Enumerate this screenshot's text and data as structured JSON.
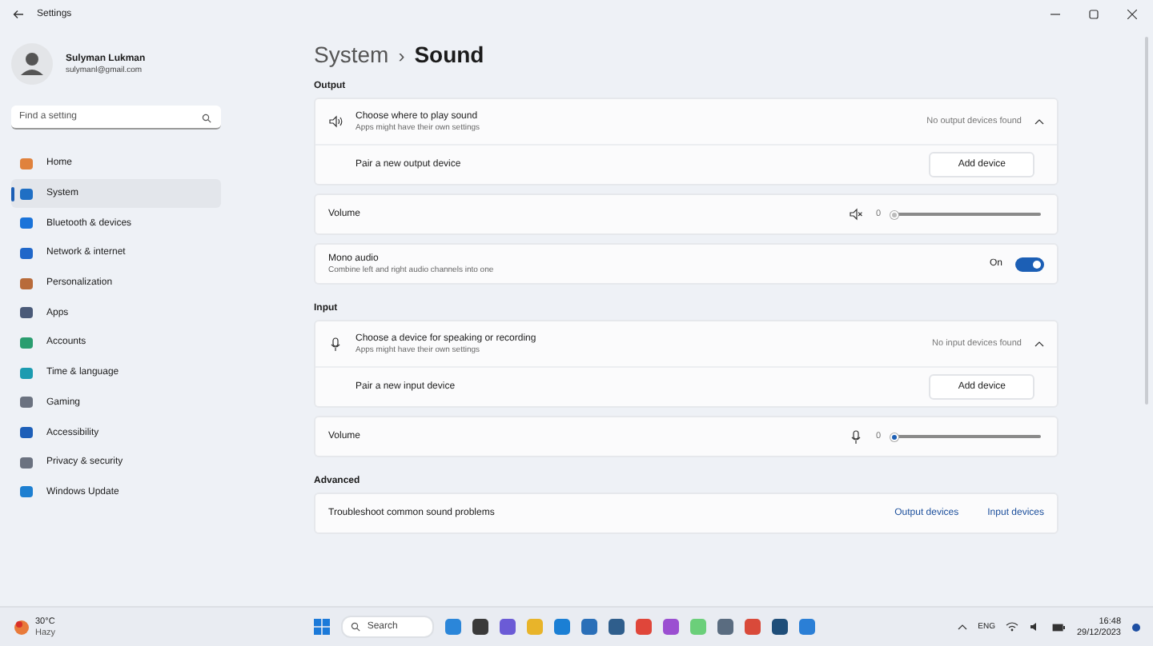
{
  "window": {
    "title": "Settings"
  },
  "profile": {
    "name": "Sulyman Lukman",
    "email": "sulymanl@gmail.com"
  },
  "search": {
    "placeholder": "Find a setting"
  },
  "nav": [
    {
      "label": "Home",
      "selected": false
    },
    {
      "label": "System",
      "selected": true
    },
    {
      "label": "Bluetooth & devices",
      "selected": false
    },
    {
      "label": "Network & internet",
      "selected": false
    },
    {
      "label": "Personalization",
      "selected": false
    },
    {
      "label": "Apps",
      "selected": false
    },
    {
      "label": "Accounts",
      "selected": false
    },
    {
      "label": "Time & language",
      "selected": false
    },
    {
      "label": "Gaming",
      "selected": false
    },
    {
      "label": "Accessibility",
      "selected": false
    },
    {
      "label": "Privacy & security",
      "selected": false
    },
    {
      "label": "Windows Update",
      "selected": false
    }
  ],
  "breadcrumb": {
    "parent": "System",
    "separator": "›",
    "current": "Sound"
  },
  "sections": [
    {
      "heading": "Output",
      "cards": [
        {
          "kind": "expander",
          "title": "Choose where to play sound",
          "subtitle": "Apps might have their own settings",
          "value": "No output devices found",
          "expanded": true,
          "sub_label": "Pair a new output device",
          "button": "Add device"
        },
        {
          "kind": "slider",
          "label": "Volume",
          "reading": "0",
          "level": 0,
          "disabled": true
        },
        {
          "kind": "toggle",
          "title": "Mono audio",
          "subtitle": "Combine left and right audio channels into one",
          "state_label": "On",
          "on": true
        }
      ]
    },
    {
      "heading": "Input",
      "cards": [
        {
          "kind": "expander",
          "title": "Choose a device for speaking or recording",
          "subtitle": "Apps might have their own settings",
          "value": "No input devices found",
          "expanded": true,
          "sub_label": "Pair a new input device",
          "button": "Add device"
        },
        {
          "kind": "slider",
          "label": "Volume",
          "reading": "0",
          "level": 0,
          "disabled": false
        }
      ]
    },
    {
      "heading": "Advanced",
      "cards": [
        {
          "kind": "links",
          "label": "Troubleshoot common sound problems",
          "links": [
            "Output devices",
            "Input devices"
          ]
        }
      ]
    }
  ],
  "taskbar": {
    "weather": {
      "temp": "30°C",
      "condition": "Hazy"
    },
    "search": "Search",
    "language": "ENG",
    "time": "16:48",
    "date": "29/12/2023"
  }
}
